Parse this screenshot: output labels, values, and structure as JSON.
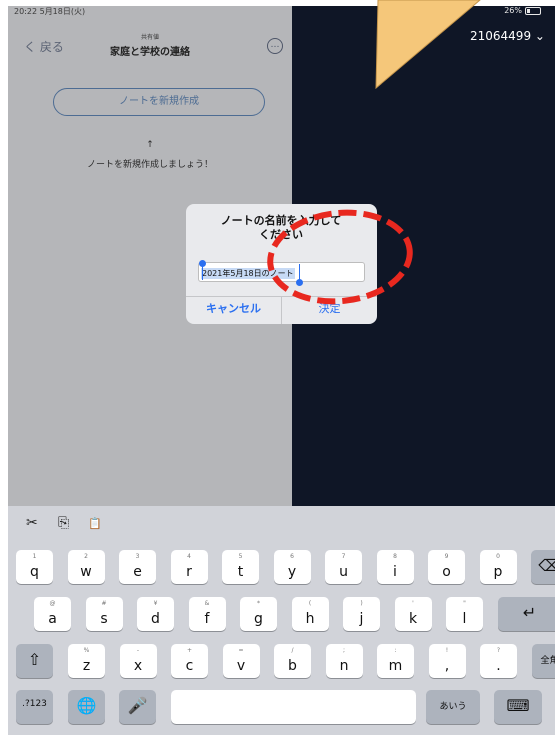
{
  "status_bar": {
    "time": "20:22 5月18日(火)",
    "battery": "26%"
  },
  "nav": {
    "back_label": "く 戻る",
    "subtitle": "共有値",
    "title": "家庭と学校の連絡",
    "more_label": "…"
  },
  "main": {
    "new_note_button": "ノートを新規作成",
    "arrow": "↑",
    "hint": "ノートを新規作成しましょう！"
  },
  "right_panel": {
    "account_label": "21064499 ⌄"
  },
  "dialog": {
    "title": "ノートの名前を入力してください",
    "input_value": "2021年5月18日のノート",
    "cancel_label": "キャンセル",
    "ok_label": "決定"
  },
  "annotation_colors": {
    "highlight_circle": "#e8281f",
    "callout_fill": "#f5c77a"
  },
  "keyboard_toolbar": {
    "cut_icon": "✂",
    "copy_icon": "⎘",
    "paste_icon": "📋"
  },
  "keyboard": {
    "row1": [
      {
        "sub": "1",
        "main": "q"
      },
      {
        "sub": "2",
        "main": "w"
      },
      {
        "sub": "3",
        "main": "e"
      },
      {
        "sub": "4",
        "main": "r"
      },
      {
        "sub": "5",
        "main": "t"
      },
      {
        "sub": "6",
        "main": "y"
      },
      {
        "sub": "7",
        "main": "u"
      },
      {
        "sub": "8",
        "main": "i"
      },
      {
        "sub": "9",
        "main": "o"
      },
      {
        "sub": "0",
        "main": "p"
      }
    ],
    "backspace": "⌫",
    "row2": [
      {
        "sub": "@",
        "main": "a"
      },
      {
        "sub": "#",
        "main": "s"
      },
      {
        "sub": "¥",
        "main": "d"
      },
      {
        "sub": "&",
        "main": "f"
      },
      {
        "sub": "*",
        "main": "g"
      },
      {
        "sub": "(",
        "main": "h"
      },
      {
        "sub": ")",
        "main": "j"
      },
      {
        "sub": "'",
        "main": "k"
      },
      {
        "sub": "\"",
        "main": "l"
      }
    ],
    "return": "↵",
    "shift": "⇧",
    "row3": [
      {
        "sub": "%",
        "main": "z"
      },
      {
        "sub": "-",
        "main": "x"
      },
      {
        "sub": "+",
        "main": "c"
      },
      {
        "sub": "=",
        "main": "v"
      },
      {
        "sub": "/",
        "main": "b"
      },
      {
        "sub": ";",
        "main": "n"
      },
      {
        "sub": ":",
        "main": "m"
      },
      {
        "sub": "!",
        "main": ","
      },
      {
        "sub": "?",
        "main": "."
      }
    ],
    "zenkaku": "全角",
    "numbers_key": ".?123",
    "globe": "🌐",
    "mic": "🎤",
    "kana": "あいう",
    "hide_keyboard": "⌨"
  }
}
